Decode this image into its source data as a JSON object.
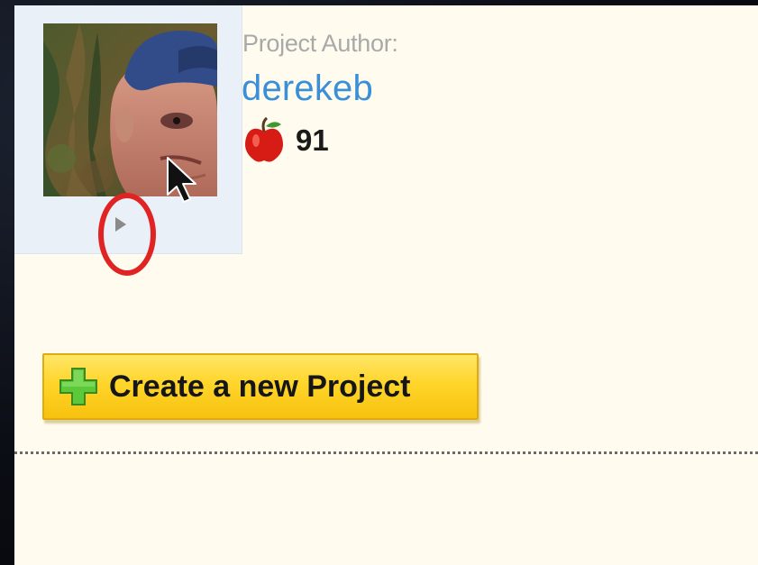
{
  "author": {
    "label": "Project Author:",
    "username": "derekeb",
    "score": "91",
    "score_icon": "apple-icon"
  },
  "avatar": {
    "toggle_icon": "play-arrow-icon",
    "highlight_color": "#e02424"
  },
  "actions": {
    "create_label": "Create a new Project",
    "create_icon": "plus-icon"
  },
  "colors": {
    "link": "#3b8fd6",
    "label": "#a9a9a9",
    "button": "#ffd52a",
    "panel": "#fffcef"
  }
}
